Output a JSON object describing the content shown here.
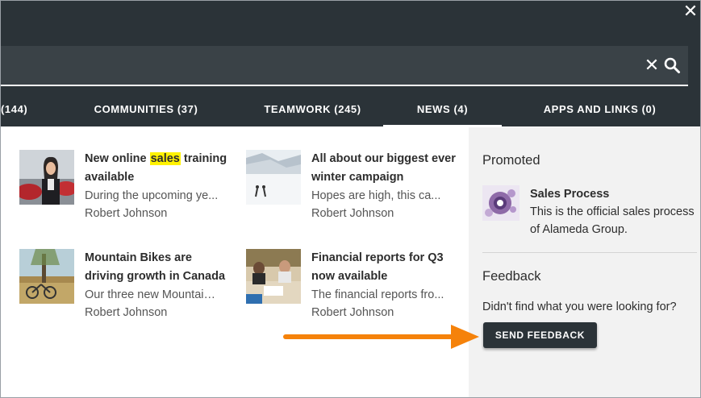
{
  "dialog": {
    "close_icon": "close-icon",
    "close_glyph": "✕"
  },
  "search": {
    "value": "",
    "placeholder": "",
    "clear_glyph": "✕",
    "icons": [
      "clear-icon",
      "search-icon"
    ]
  },
  "tabs": [
    {
      "label": "(144)",
      "active": false
    },
    {
      "label": "COMMUNITIES (37)",
      "active": false
    },
    {
      "label": "TEAMWORK (245)",
      "active": false
    },
    {
      "label": "NEWS (4)",
      "active": true
    },
    {
      "label": "APPS AND LINKS (0)",
      "active": false
    }
  ],
  "results": [
    {
      "title_before": "New online ",
      "title_highlight": "sales",
      "title_after": " training available",
      "description": "During the upcoming ye...",
      "author": "Robert Johnson",
      "thumbnail": "saleswoman-photo"
    },
    {
      "title": "All about our biggest ever winter campaign",
      "description": "Hopes are high, this ca...",
      "author": "Robert Johnson",
      "thumbnail": "snow-ski-photo"
    },
    {
      "title": "Mountain Bikes are driving growth in Canada",
      "description": "Our three new Mountain ...",
      "author": "Robert Johnson",
      "thumbnail": "mountain-bike-photo"
    },
    {
      "title": "Financial reports for Q3 now available",
      "description": "The financial reports fro...",
      "author": "Robert Johnson",
      "thumbnail": "office-meeting-photo"
    }
  ],
  "sidebar": {
    "promoted_heading": "Promoted",
    "promoted_item": {
      "title": "Sales Process",
      "description": "This is the official sales process of Alameda Group.",
      "thumbnail": "sales-process-graphic"
    },
    "feedback_heading": "Feedback",
    "feedback_text": "Didn't find what you were looking for?",
    "feedback_button": "SEND FEEDBACK"
  },
  "annotation": {
    "arrow_color": "#f5820a"
  },
  "colors": {
    "header_bg": "#2b3338",
    "highlight": "#fff200",
    "sidebar_bg": "#f2f2f2"
  }
}
